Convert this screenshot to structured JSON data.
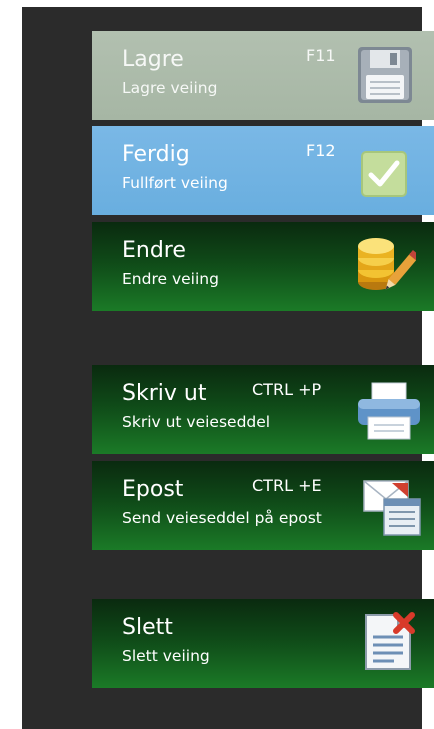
{
  "buttons": [
    {
      "title": "Lagre",
      "subtitle": "Lagre veiing",
      "shortcut": "F11",
      "icon": "floppy-disk-icon"
    },
    {
      "title": "Ferdig",
      "subtitle": "Fullført veiing",
      "shortcut": "F12",
      "icon": "checkmark-icon"
    },
    {
      "title": "Endre",
      "subtitle": "Endre veiing",
      "shortcut": "",
      "icon": "database-edit-icon"
    },
    {
      "title": "Skriv ut",
      "subtitle": "Skriv ut veieseddel",
      "shortcut": "CTRL +P",
      "icon": "printer-icon"
    },
    {
      "title": "Epost",
      "subtitle": "Send veieseddel på epost",
      "shortcut": "CTRL +E",
      "icon": "email-document-icon"
    },
    {
      "title": "Slett",
      "subtitle": "Slett veiing",
      "shortcut": "",
      "icon": "delete-document-icon"
    }
  ],
  "colors": {
    "panel_bg": "#2b2b2b",
    "lagre_bg": "#aebbaa",
    "ferdig_bg": "#74b4e3",
    "green_bg": "#13591d"
  }
}
